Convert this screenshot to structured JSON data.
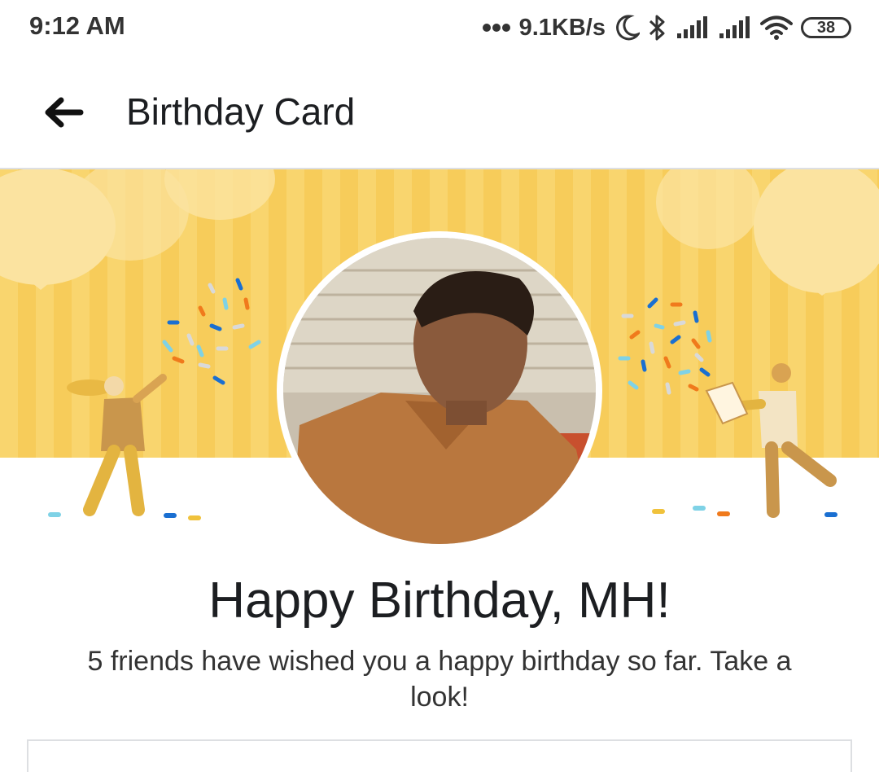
{
  "status_bar": {
    "time": "9:12 AM",
    "net_speed": "9.1KB/s",
    "battery": "38",
    "icons": [
      "more-dots-icon",
      "moon-icon",
      "bluetooth-icon",
      "signal-icon",
      "signal-icon",
      "wifi-icon",
      "battery-icon"
    ]
  },
  "app_bar": {
    "title": "Birthday Card",
    "back_icon": "arrow-left-icon"
  },
  "card": {
    "greeting": "Happy Birthday, MH!",
    "subtext": "5 friends have wished you a happy birthday so far. Take a look!"
  },
  "colors": {
    "banner_yellow": "#f9d56e",
    "banner_stripe": "#f7cd5c",
    "accent_blue": "#1877f2"
  }
}
